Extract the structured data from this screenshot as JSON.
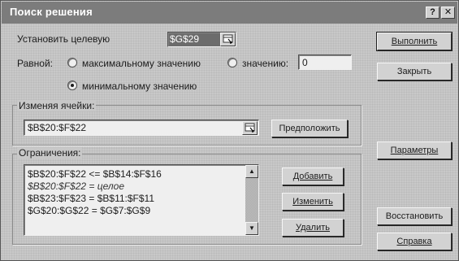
{
  "window": {
    "title": "Поиск решения",
    "help_label": "?",
    "close_label": "✕"
  },
  "target": {
    "label": "Установить целевую",
    "cell_value": "$G$29"
  },
  "equal_to": {
    "label": "Равной:",
    "options": [
      {
        "label": "максимальному значению",
        "selected": false
      },
      {
        "label": "значению:",
        "selected": false
      },
      {
        "label": "минимальному значению",
        "selected": true
      }
    ],
    "value_field": "0"
  },
  "changing_cells": {
    "label": "Изменяя ячейки:",
    "value": "$B$20:$F$22",
    "guess_button": "Предположить"
  },
  "constraints": {
    "label": "Ограничения:",
    "items": [
      "$B$20:$F$22 <= $B$14:$F$16",
      "$B$20:$F$22 = целое",
      "$B$23:$F$23 = $B$11:$F$11",
      "$G$20:$G$22 = $G$7:$G$9"
    ],
    "add_button": "Добавить",
    "change_button": "Изменить",
    "delete_button": "Удалить"
  },
  "side_buttons": {
    "solve": "Выполнить",
    "close": "Закрыть",
    "options": "Параметры",
    "reset": "Восстановить",
    "help": "Справка"
  },
  "icons": {
    "ref_button": "range-select-icon",
    "scroll_up": "scroll-up-arrow-icon",
    "scroll_down": "scroll-down-arrow-icon"
  }
}
